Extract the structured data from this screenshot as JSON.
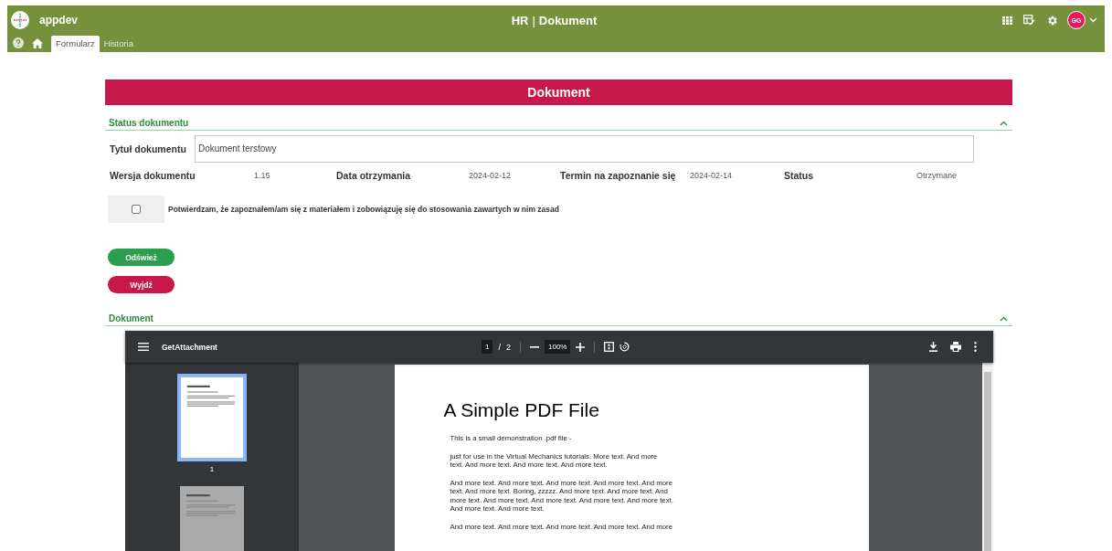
{
  "header": {
    "app_name": "appdev",
    "module": "HR",
    "separator": "|",
    "title": "Dokument",
    "avatar": "GG"
  },
  "tabs": [
    {
      "label": "Formularz",
      "selected": true
    },
    {
      "label": "Historia",
      "selected": false
    }
  ],
  "banner": "Dokument",
  "status_section": {
    "title": "Status dokumentu",
    "expanded": true,
    "title_field": {
      "label": "Tytuł dokumentu",
      "value": "Dokument terstowy"
    },
    "fields": [
      {
        "label": "Wersja dokumentu",
        "value": "1.15"
      },
      {
        "label": "Data otrzymania",
        "value": "2024-02-12"
      },
      {
        "label": "Termin na zapoznanie się",
        "value": "2024-02-14"
      },
      {
        "label": "Status",
        "value": "Otrzymane"
      }
    ],
    "confirmation": {
      "label": "Potwierdzam, że zapoznałem/am się z materiałem i zobowiązuję się do stosowania zawartych w nim zasad",
      "checked": false
    }
  },
  "buttons": [
    {
      "label": "Odśwież",
      "kind": "refresh"
    },
    {
      "label": "Wyjdź",
      "kind": "exit"
    }
  ],
  "document_section": {
    "title": "Dokument",
    "expanded": true
  },
  "viewer": {
    "file_name": "GetAttachment",
    "page": "1",
    "page_count": "2",
    "separator": "/",
    "zoom": "100%",
    "thumbnails": [
      {
        "number": "1",
        "selected": true
      },
      {
        "selected": false
      }
    ],
    "page_title": "A Simple PDF File",
    "paragraphs": [
      [
        "This is a small demonstration .pdf file -"
      ],
      [
        "just for use in the Virtual Mechanics tutorials. More text. And more",
        "text. And more text. And more text. And more text."
      ],
      [
        "And more text. And more text. And more text. And more text. And more",
        "text. And more text. Boring, zzzzz. And more text. And more text. And",
        "more text. And more text. And more text. And more text. And more text.",
        "And more text. And more text."
      ],
      [
        "And more text. And more text. And more text. And more text. And more"
      ]
    ]
  }
}
